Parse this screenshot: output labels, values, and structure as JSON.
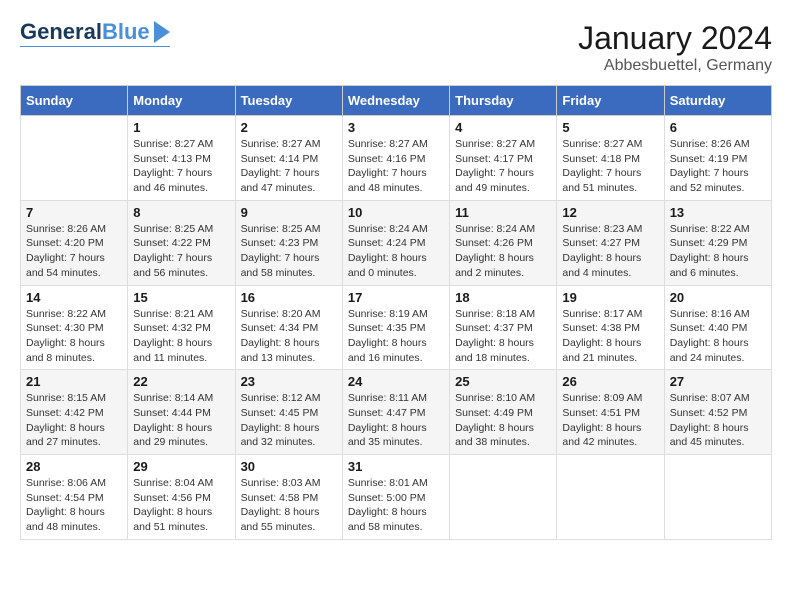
{
  "header": {
    "logo_line1": "General",
    "logo_line2": "Blue",
    "title": "January 2024",
    "subtitle": "Abbesbuettel, Germany"
  },
  "days_of_week": [
    "Sunday",
    "Monday",
    "Tuesday",
    "Wednesday",
    "Thursday",
    "Friday",
    "Saturday"
  ],
  "weeks": [
    [
      {
        "num": "",
        "sunrise": "",
        "sunset": "",
        "daylight": ""
      },
      {
        "num": "1",
        "sunrise": "Sunrise: 8:27 AM",
        "sunset": "Sunset: 4:13 PM",
        "daylight": "Daylight: 7 hours and 46 minutes."
      },
      {
        "num": "2",
        "sunrise": "Sunrise: 8:27 AM",
        "sunset": "Sunset: 4:14 PM",
        "daylight": "Daylight: 7 hours and 47 minutes."
      },
      {
        "num": "3",
        "sunrise": "Sunrise: 8:27 AM",
        "sunset": "Sunset: 4:16 PM",
        "daylight": "Daylight: 7 hours and 48 minutes."
      },
      {
        "num": "4",
        "sunrise": "Sunrise: 8:27 AM",
        "sunset": "Sunset: 4:17 PM",
        "daylight": "Daylight: 7 hours and 49 minutes."
      },
      {
        "num": "5",
        "sunrise": "Sunrise: 8:27 AM",
        "sunset": "Sunset: 4:18 PM",
        "daylight": "Daylight: 7 hours and 51 minutes."
      },
      {
        "num": "6",
        "sunrise": "Sunrise: 8:26 AM",
        "sunset": "Sunset: 4:19 PM",
        "daylight": "Daylight: 7 hours and 52 minutes."
      }
    ],
    [
      {
        "num": "7",
        "sunrise": "Sunrise: 8:26 AM",
        "sunset": "Sunset: 4:20 PM",
        "daylight": "Daylight: 7 hours and 54 minutes."
      },
      {
        "num": "8",
        "sunrise": "Sunrise: 8:25 AM",
        "sunset": "Sunset: 4:22 PM",
        "daylight": "Daylight: 7 hours and 56 minutes."
      },
      {
        "num": "9",
        "sunrise": "Sunrise: 8:25 AM",
        "sunset": "Sunset: 4:23 PM",
        "daylight": "Daylight: 7 hours and 58 minutes."
      },
      {
        "num": "10",
        "sunrise": "Sunrise: 8:24 AM",
        "sunset": "Sunset: 4:24 PM",
        "daylight": "Daylight: 8 hours and 0 minutes."
      },
      {
        "num": "11",
        "sunrise": "Sunrise: 8:24 AM",
        "sunset": "Sunset: 4:26 PM",
        "daylight": "Daylight: 8 hours and 2 minutes."
      },
      {
        "num": "12",
        "sunrise": "Sunrise: 8:23 AM",
        "sunset": "Sunset: 4:27 PM",
        "daylight": "Daylight: 8 hours and 4 minutes."
      },
      {
        "num": "13",
        "sunrise": "Sunrise: 8:22 AM",
        "sunset": "Sunset: 4:29 PM",
        "daylight": "Daylight: 8 hours and 6 minutes."
      }
    ],
    [
      {
        "num": "14",
        "sunrise": "Sunrise: 8:22 AM",
        "sunset": "Sunset: 4:30 PM",
        "daylight": "Daylight: 8 hours and 8 minutes."
      },
      {
        "num": "15",
        "sunrise": "Sunrise: 8:21 AM",
        "sunset": "Sunset: 4:32 PM",
        "daylight": "Daylight: 8 hours and 11 minutes."
      },
      {
        "num": "16",
        "sunrise": "Sunrise: 8:20 AM",
        "sunset": "Sunset: 4:34 PM",
        "daylight": "Daylight: 8 hours and 13 minutes."
      },
      {
        "num": "17",
        "sunrise": "Sunrise: 8:19 AM",
        "sunset": "Sunset: 4:35 PM",
        "daylight": "Daylight: 8 hours and 16 minutes."
      },
      {
        "num": "18",
        "sunrise": "Sunrise: 8:18 AM",
        "sunset": "Sunset: 4:37 PM",
        "daylight": "Daylight: 8 hours and 18 minutes."
      },
      {
        "num": "19",
        "sunrise": "Sunrise: 8:17 AM",
        "sunset": "Sunset: 4:38 PM",
        "daylight": "Daylight: 8 hours and 21 minutes."
      },
      {
        "num": "20",
        "sunrise": "Sunrise: 8:16 AM",
        "sunset": "Sunset: 4:40 PM",
        "daylight": "Daylight: 8 hours and 24 minutes."
      }
    ],
    [
      {
        "num": "21",
        "sunrise": "Sunrise: 8:15 AM",
        "sunset": "Sunset: 4:42 PM",
        "daylight": "Daylight: 8 hours and 27 minutes."
      },
      {
        "num": "22",
        "sunrise": "Sunrise: 8:14 AM",
        "sunset": "Sunset: 4:44 PM",
        "daylight": "Daylight: 8 hours and 29 minutes."
      },
      {
        "num": "23",
        "sunrise": "Sunrise: 8:12 AM",
        "sunset": "Sunset: 4:45 PM",
        "daylight": "Daylight: 8 hours and 32 minutes."
      },
      {
        "num": "24",
        "sunrise": "Sunrise: 8:11 AM",
        "sunset": "Sunset: 4:47 PM",
        "daylight": "Daylight: 8 hours and 35 minutes."
      },
      {
        "num": "25",
        "sunrise": "Sunrise: 8:10 AM",
        "sunset": "Sunset: 4:49 PM",
        "daylight": "Daylight: 8 hours and 38 minutes."
      },
      {
        "num": "26",
        "sunrise": "Sunrise: 8:09 AM",
        "sunset": "Sunset: 4:51 PM",
        "daylight": "Daylight: 8 hours and 42 minutes."
      },
      {
        "num": "27",
        "sunrise": "Sunrise: 8:07 AM",
        "sunset": "Sunset: 4:52 PM",
        "daylight": "Daylight: 8 hours and 45 minutes."
      }
    ],
    [
      {
        "num": "28",
        "sunrise": "Sunrise: 8:06 AM",
        "sunset": "Sunset: 4:54 PM",
        "daylight": "Daylight: 8 hours and 48 minutes."
      },
      {
        "num": "29",
        "sunrise": "Sunrise: 8:04 AM",
        "sunset": "Sunset: 4:56 PM",
        "daylight": "Daylight: 8 hours and 51 minutes."
      },
      {
        "num": "30",
        "sunrise": "Sunrise: 8:03 AM",
        "sunset": "Sunset: 4:58 PM",
        "daylight": "Daylight: 8 hours and 55 minutes."
      },
      {
        "num": "31",
        "sunrise": "Sunrise: 8:01 AM",
        "sunset": "Sunset: 5:00 PM",
        "daylight": "Daylight: 8 hours and 58 minutes."
      },
      {
        "num": "",
        "sunrise": "",
        "sunset": "",
        "daylight": ""
      },
      {
        "num": "",
        "sunrise": "",
        "sunset": "",
        "daylight": ""
      },
      {
        "num": "",
        "sunrise": "",
        "sunset": "",
        "daylight": ""
      }
    ]
  ]
}
